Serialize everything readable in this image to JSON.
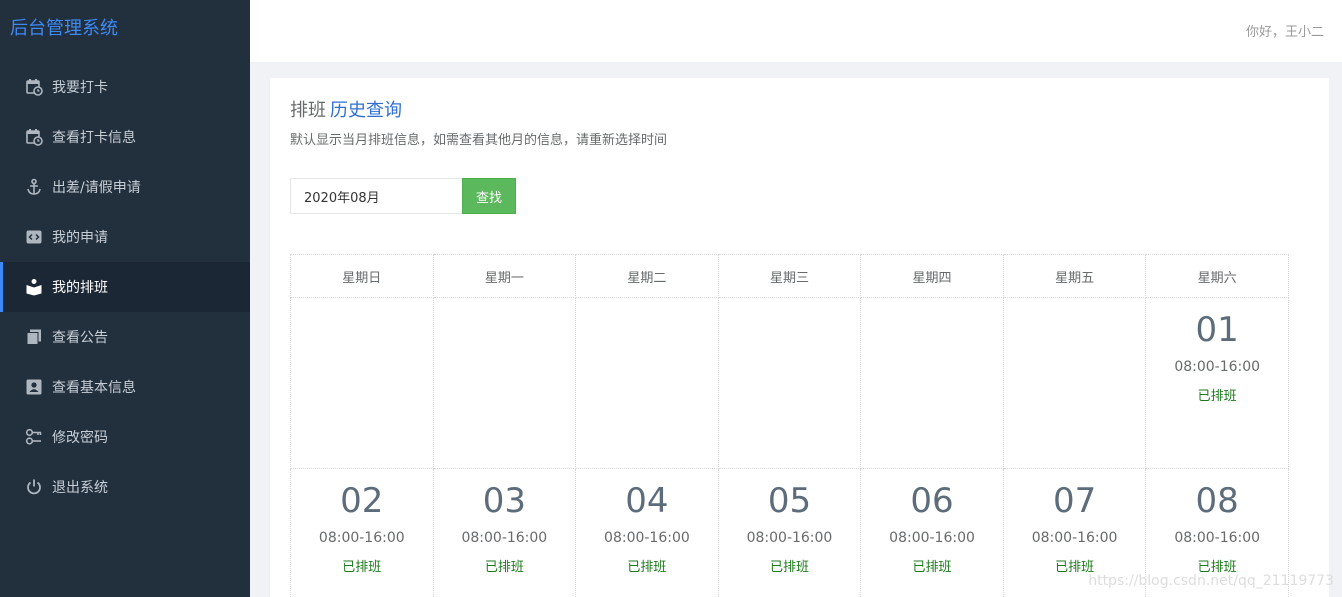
{
  "brand": "后台管理系统",
  "greeting": "你好，王小二",
  "menu": [
    {
      "label": "我要打卡",
      "icon": "calendar-clock-icon"
    },
    {
      "label": "查看打卡信息",
      "icon": "calendar-clock-icon"
    },
    {
      "label": "出差/请假申请",
      "icon": "anchor-icon"
    },
    {
      "label": "我的申请",
      "icon": "code-icon"
    },
    {
      "label": "我的排班",
      "icon": "book-reader-icon",
      "active": true
    },
    {
      "label": "查看公告",
      "icon": "copy-icon"
    },
    {
      "label": "查看基本信息",
      "icon": "id-card-icon"
    },
    {
      "label": "修改密码",
      "icon": "key-icon"
    },
    {
      "label": "退出系统",
      "icon": "power-icon"
    }
  ],
  "page": {
    "title_prefix": "排班",
    "title_accent": "历史查询",
    "subtitle": "默认显示当月排班信息，如需查看其他月的信息，请重新选择时间"
  },
  "search": {
    "value": "2020年08月",
    "button": "查找"
  },
  "calendar": {
    "weekdays": [
      "星期日",
      "星期一",
      "星期二",
      "星期三",
      "星期四",
      "星期五",
      "星期六"
    ],
    "weeks": [
      [
        null,
        null,
        null,
        null,
        null,
        null,
        {
          "day": "01",
          "time": "08:00-16:00",
          "status": "已排班"
        }
      ],
      [
        {
          "day": "02",
          "time": "08:00-16:00",
          "status": "已排班"
        },
        {
          "day": "03",
          "time": "08:00-16:00",
          "status": "已排班"
        },
        {
          "day": "04",
          "time": "08:00-16:00",
          "status": "已排班"
        },
        {
          "day": "05",
          "time": "08:00-16:00",
          "status": "已排班"
        },
        {
          "day": "06",
          "time": "08:00-16:00",
          "status": "已排班"
        },
        {
          "day": "07",
          "time": "08:00-16:00",
          "status": "已排班"
        },
        {
          "day": "08",
          "time": "08:00-16:00",
          "status": "已排班"
        }
      ]
    ]
  },
  "watermark": "https://blog.csdn.net/qq_21119773",
  "colors": {
    "sidebar_bg": "#22303e",
    "accent": "#3d8af7",
    "button_green": "#5cb85c",
    "status_green": "#1c7a1c"
  }
}
